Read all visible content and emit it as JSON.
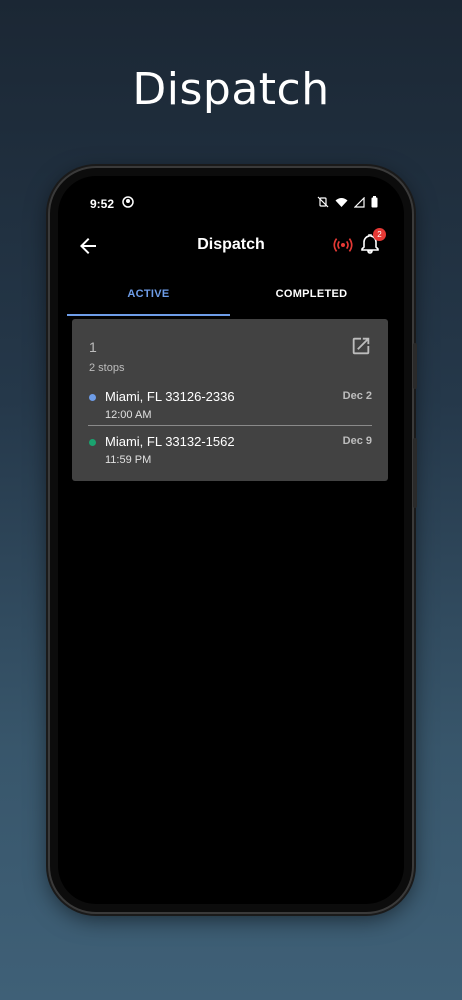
{
  "promo": {
    "title": "Dispatch"
  },
  "status_bar": {
    "time": "9:52"
  },
  "app_bar": {
    "title": "Dispatch",
    "notification_count": "2"
  },
  "tabs": [
    {
      "label": "ACTIVE",
      "active": true
    },
    {
      "label": "COMPLETED",
      "active": false
    }
  ],
  "dispatch_card": {
    "number": "1",
    "stops_label": "2 stops",
    "stops": [
      {
        "address": "Miami, FL 33126-2336",
        "time": "12:00 AM",
        "date": "Dec 2",
        "dot_color": "#6e9de8"
      },
      {
        "address": "Miami, FL 33132-1562",
        "time": "11:59 PM",
        "date": "Dec 9",
        "dot_color": "#1aa36f"
      }
    ]
  },
  "colors": {
    "accent": "#6e9de8",
    "alert": "#e53935",
    "card_bg": "#424242"
  },
  "icons": {
    "back": "arrow-left-icon",
    "signal": "broadcast-signal-icon",
    "bell": "bell-icon",
    "open": "open-in-new-icon"
  }
}
